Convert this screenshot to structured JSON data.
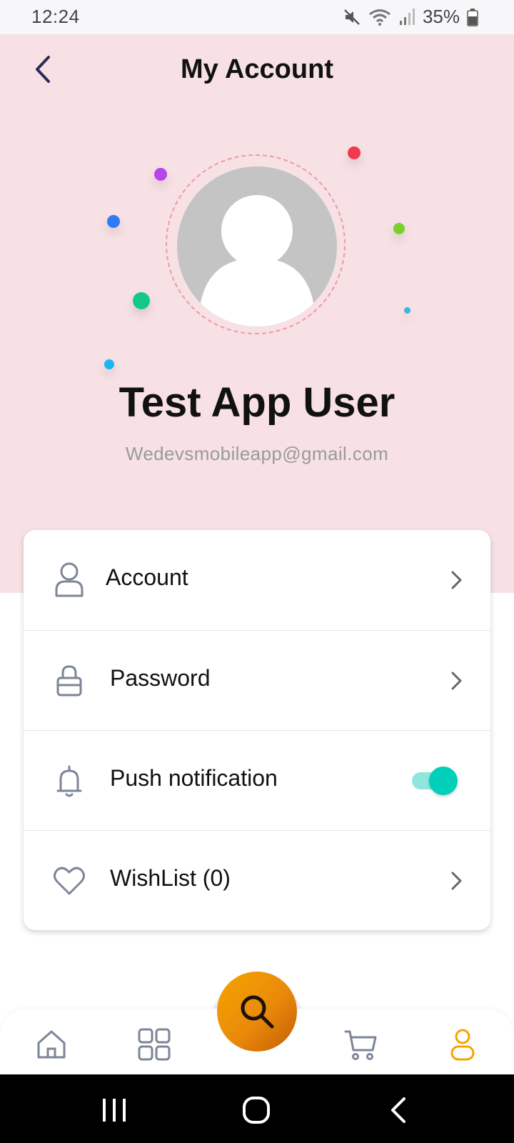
{
  "status_bar": {
    "time": "12:24",
    "battery": "35%",
    "icons": [
      "mute-icon",
      "wifi-icon",
      "signal-icon",
      "battery-icon"
    ]
  },
  "header": {
    "title": "My Account",
    "back_icon": "chevron-left-icon"
  },
  "profile": {
    "name": "Test App User",
    "email": "Wedevsmobileapp@gmail.com",
    "avatar_icon": "user-placeholder-icon"
  },
  "settings": {
    "items": [
      {
        "label": "Account",
        "icon": "user-icon",
        "action": "chevron-right-icon"
      },
      {
        "label": "Password",
        "icon": "lock-icon",
        "action": "chevron-right-icon"
      },
      {
        "label": "Push notification",
        "icon": "bell-icon",
        "action": "toggle",
        "toggle_on": true
      },
      {
        "label": "WishList (0)",
        "icon": "heart-icon",
        "action": "chevron-right-icon"
      }
    ]
  },
  "bottom_nav": {
    "items": [
      "home-icon",
      "grid-icon",
      "search-icon",
      "cart-icon",
      "profile-icon"
    ],
    "active": "profile-icon"
  },
  "colors": {
    "header_bg": "#f7e1e5",
    "accent_orange": "#f5a400",
    "toggle_teal": "#00cfb9",
    "icon_gray": "#7c8597",
    "back_navy": "#2c2a58"
  }
}
